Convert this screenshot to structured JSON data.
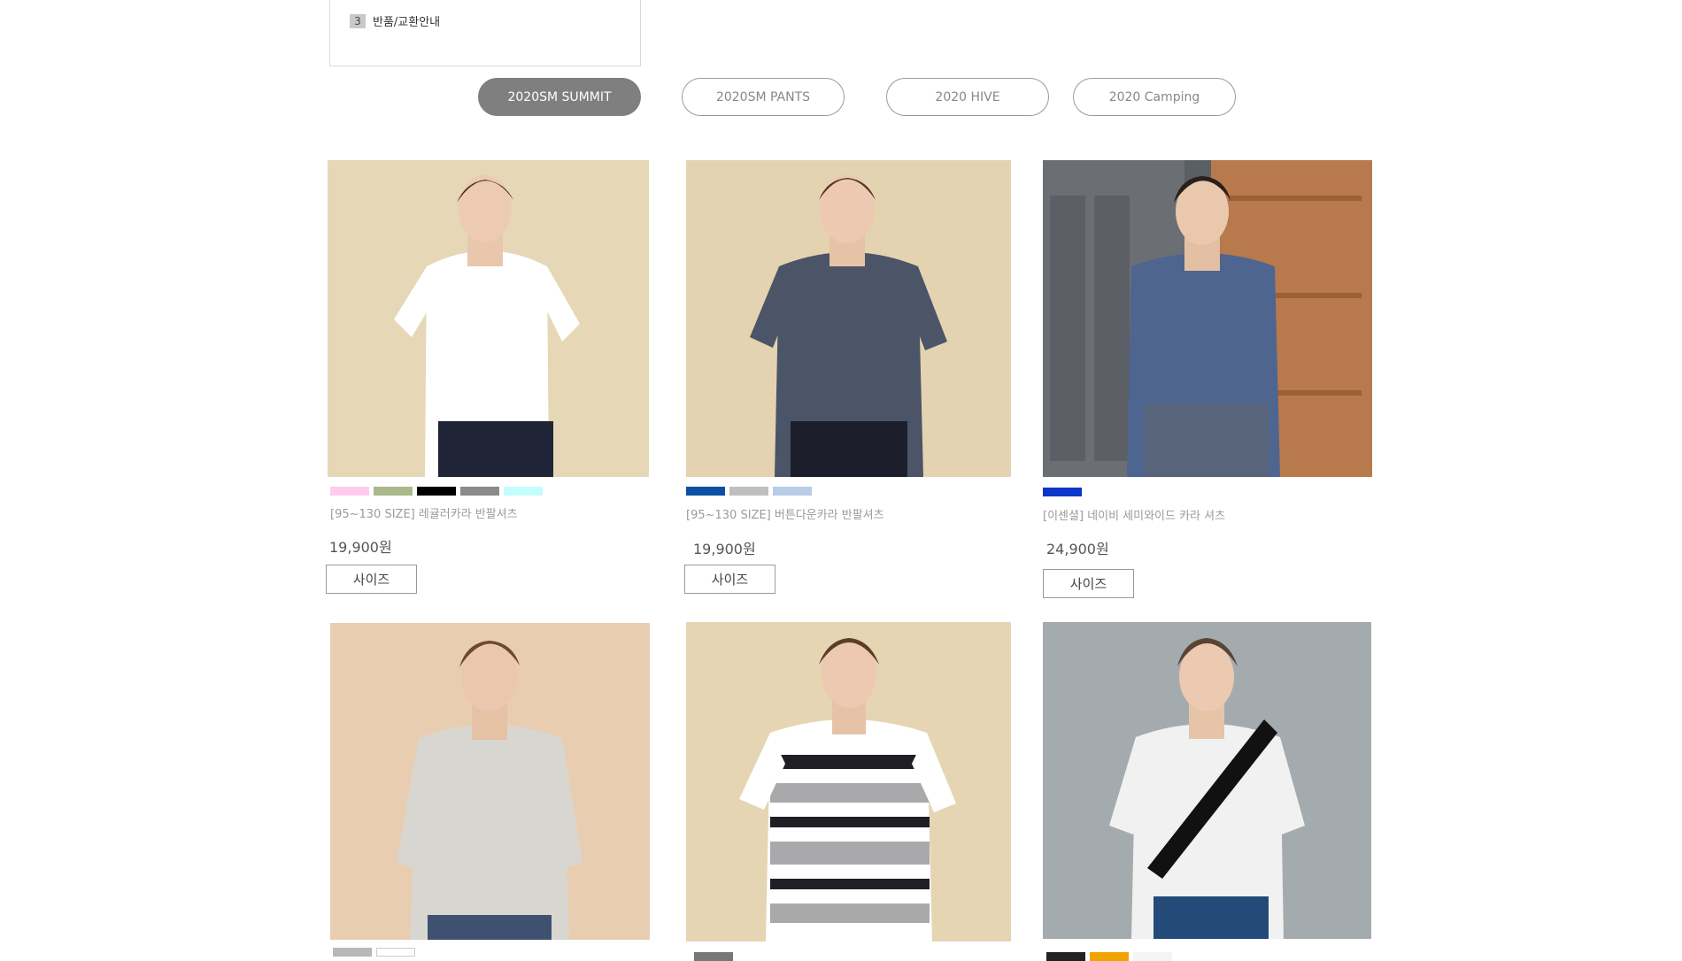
{
  "notice": {
    "number": "3",
    "text": "반품/교환안내"
  },
  "tabs": [
    {
      "label": "2020SM SUMMIT",
      "active": true
    },
    {
      "label": "2020SM PANTS",
      "active": false
    },
    {
      "label": "2020 HIVE",
      "active": false
    },
    {
      "label": "2020 Camping",
      "active": false
    }
  ],
  "products": [
    {
      "name": "[95~130 SIZE] 레귤러카라 반팔셔츠",
      "price": "19,900원",
      "size_label": "사이즈",
      "swatches": [
        "#ffccee",
        "#a9b98a",
        "#000000",
        "#8a8a8a",
        "#c4fdfd"
      ]
    },
    {
      "name": "[95~130 SIZE] 버튼다운카라 반팔셔츠",
      "price": "19,900원",
      "size_label": "사이즈",
      "swatches": [
        "#0d4fa3",
        "#bfbfbf",
        "#b7cde8"
      ]
    },
    {
      "name": "[이센셜] 네이비 세미와이드 카라 셔츠",
      "price": "24,900원",
      "size_label": "사이즈",
      "swatches": [
        "#0b36c9"
      ]
    },
    {
      "swatches": [
        "#b8b8b8",
        "#ffffff"
      ]
    },
    {
      "swatches": [
        "#777777"
      ]
    },
    {
      "swatches": [
        "#222222",
        "#f0a400",
        "#f5f5f7"
      ]
    }
  ]
}
